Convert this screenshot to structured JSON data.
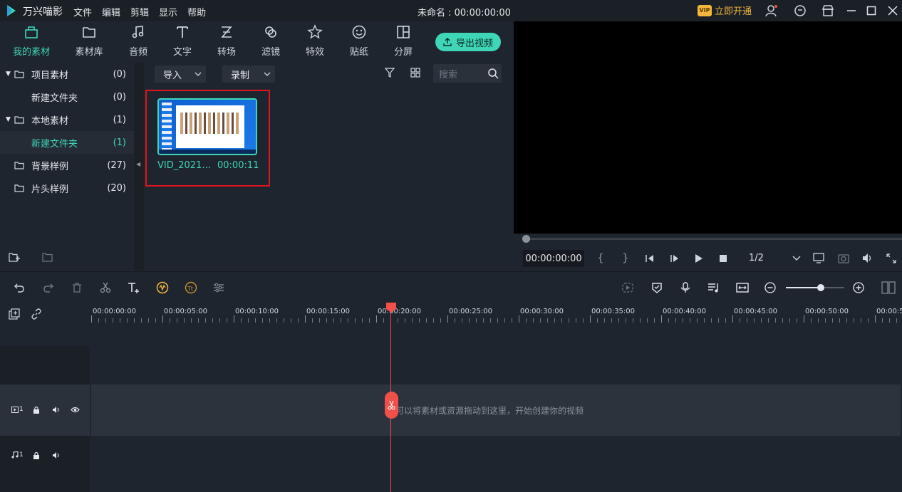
{
  "app": {
    "name": "万兴喵影"
  },
  "menu": {
    "items": [
      "文件",
      "编辑",
      "剪辑",
      "显示",
      "帮助"
    ]
  },
  "project": {
    "title": "未命名 : 00:00:00:00"
  },
  "vip": {
    "badge": "VIP",
    "label": "立即开通"
  },
  "toolbar": {
    "tabs": [
      {
        "label": "我的素材",
        "icon": "my-media-icon",
        "active": true
      },
      {
        "label": "素材库",
        "icon": "stock-library-icon"
      },
      {
        "label": "音频",
        "icon": "audio-note-icon"
      },
      {
        "label": "文字",
        "icon": "text-icon"
      },
      {
        "label": "转场",
        "icon": "transition-icon"
      },
      {
        "label": "滤镜",
        "icon": "filter-icon"
      },
      {
        "label": "特效",
        "icon": "effects-icon"
      },
      {
        "label": "贴纸",
        "icon": "sticker-icon"
      },
      {
        "label": "分屏",
        "icon": "split-screen-icon"
      }
    ],
    "export_label": "导出视频",
    "accent": "#3fd6b8"
  },
  "tree": {
    "items": [
      {
        "label": "项目素材",
        "count": "(0)"
      },
      {
        "label": "新建文件夹",
        "count": "(0)"
      },
      {
        "label": "本地素材",
        "count": "(1)"
      },
      {
        "label": "新建文件夹",
        "count": "(1)"
      },
      {
        "label": "背景样例",
        "count": "(27)"
      },
      {
        "label": "片头样例",
        "count": "(20)"
      }
    ]
  },
  "media": {
    "import_label": "导入",
    "record_label": "录制",
    "search_placeholder": "搜索",
    "clip": {
      "name": "VID_2021…",
      "duration": "00:00:11"
    },
    "highlight_color": "#e0141e"
  },
  "preview": {
    "timecode": "00:00:00:00",
    "brace_open": "{",
    "brace_close": "}",
    "quality": "1/2"
  },
  "timeline": {
    "ruler": [
      "00:00:00:00",
      "00:00:05:00",
      "00:00:10:00",
      "00:00:15:00",
      "00:00:20:00",
      "00:00:25:00",
      "00:00:30:00",
      "00:00:35:00",
      "00:00:40:00",
      "00:00:45:00",
      "00:00:50:00",
      "00:00:5"
    ],
    "video_track_num": "1",
    "audio_track_num": "1",
    "drop_hint": "可以将素材或资源拖动到这里，开始创建你的视频",
    "playhead_color": "#f0504a"
  }
}
